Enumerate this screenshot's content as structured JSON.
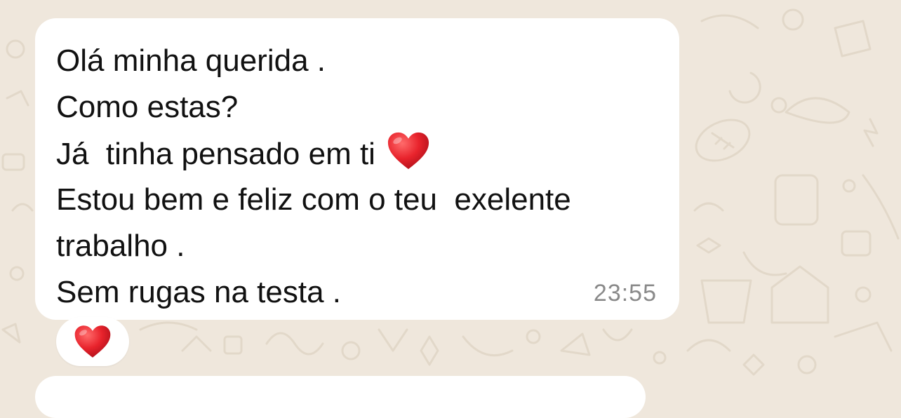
{
  "chat": {
    "background_color": "#efe7dc",
    "bubble_color": "#ffffff",
    "message": {
      "lines": [
        "Olá minha querida .",
        "Como estas?",
        "Já  tinha pensado em ti",
        "Estou bem e feliz com o teu  exelente",
        "trabalho .",
        "Sem rugas na testa ."
      ],
      "inline_emoji": "heart-icon",
      "time": "23:55"
    },
    "reaction": {
      "emoji": "heart-icon",
      "color": "#e8232c"
    }
  }
}
